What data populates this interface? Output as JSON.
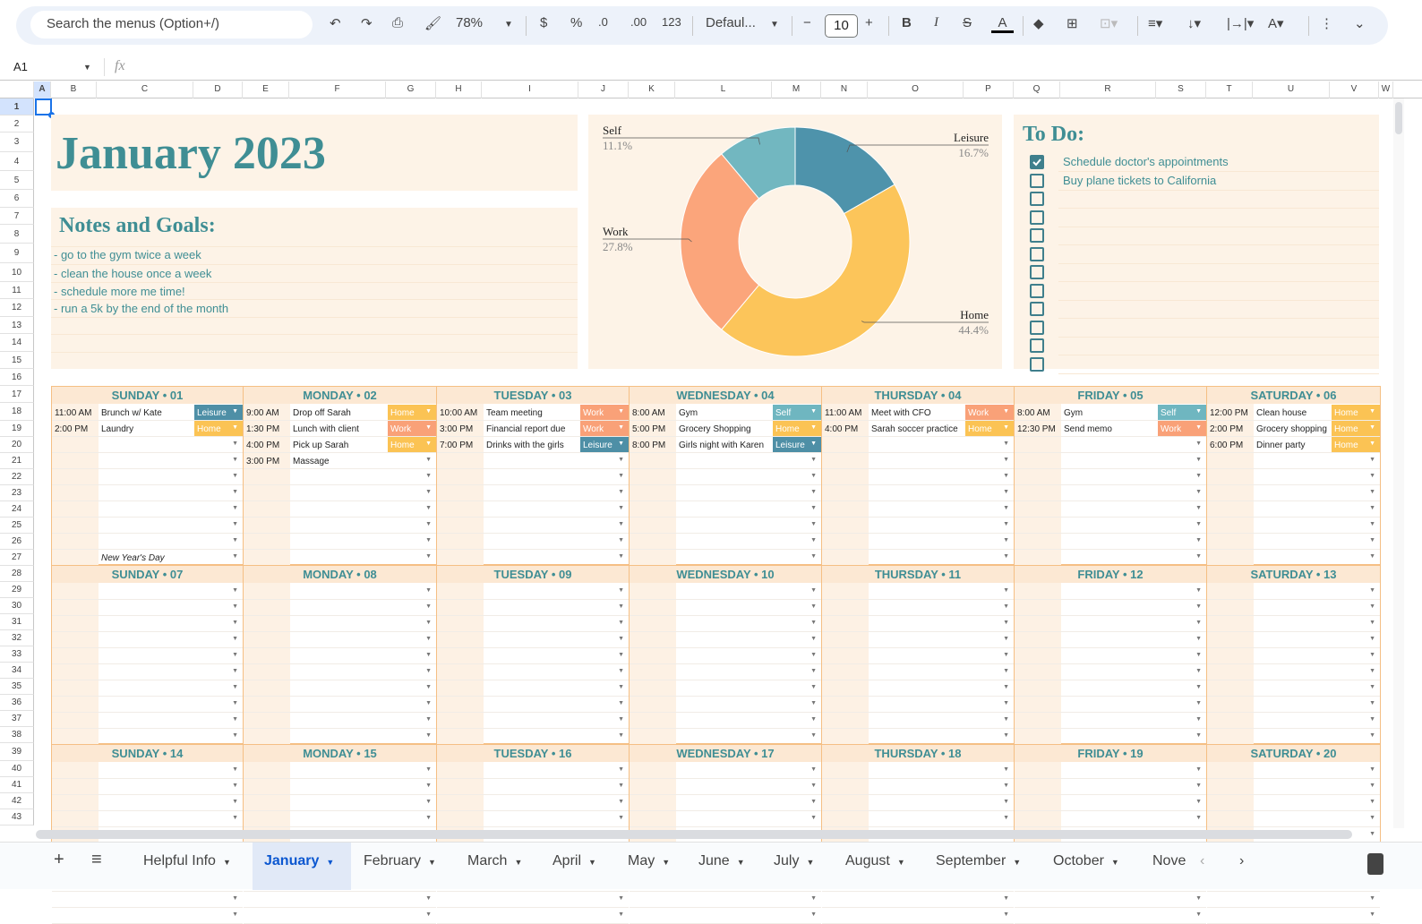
{
  "toolbar": {
    "search_placeholder": "Search the menus (Option+/)",
    "zoom": "78%",
    "currency": "$",
    "percent": "%",
    "dec_less": ".0",
    "dec_more": ".00",
    "format_123": "123",
    "font": "Defaul...",
    "font_size": "10",
    "bold": "B",
    "italic": "I",
    "text_color": "A"
  },
  "formula_bar": {
    "cell_ref": "A1",
    "fx": "fx"
  },
  "columns": [
    "A",
    "B",
    "C",
    "D",
    "E",
    "F",
    "G",
    "H",
    "I",
    "J",
    "K",
    "L",
    "M",
    "N",
    "O",
    "P",
    "Q",
    "R",
    "S",
    "T",
    "U",
    "V",
    "W"
  ],
  "rows": [
    1,
    2,
    3,
    4,
    5,
    6,
    7,
    8,
    9,
    10,
    11,
    12,
    13,
    14,
    15,
    16,
    17,
    18,
    19,
    20,
    21,
    22,
    23,
    24,
    25,
    26,
    27,
    28,
    29,
    30,
    31,
    32,
    33,
    34,
    35,
    36,
    37,
    38,
    39,
    40,
    41,
    42,
    43
  ],
  "header": {
    "title": "January 2023"
  },
  "notes": {
    "title": "Notes and Goals:",
    "items": [
      "- go to the gym twice a week",
      "- clean the house once a week",
      "- schedule more me time!",
      "- run a 5k by the end of the month"
    ]
  },
  "chart_data": {
    "type": "pie",
    "donut": true,
    "categories": [
      "Leisure",
      "Home",
      "Work",
      "Self"
    ],
    "values": [
      16.7,
      44.4,
      27.8,
      11.1
    ],
    "labels": [
      "16.7%",
      "44.4%",
      "27.8%",
      "11.1%"
    ],
    "colors": [
      "#4e93ab",
      "#fcc55a",
      "#fba57b",
      "#72b7c0"
    ]
  },
  "todo": {
    "title": "To Do:",
    "items": [
      {
        "text": "Schedule doctor's appointments",
        "checked": true
      },
      {
        "text": "Buy plane tickets to California",
        "checked": false
      },
      {
        "text": "",
        "checked": false
      },
      {
        "text": "",
        "checked": false
      },
      {
        "text": "",
        "checked": false
      },
      {
        "text": "",
        "checked": false
      },
      {
        "text": "",
        "checked": false
      },
      {
        "text": "",
        "checked": false
      },
      {
        "text": "",
        "checked": false
      },
      {
        "text": "",
        "checked": false
      },
      {
        "text": "",
        "checked": false
      },
      {
        "text": "",
        "checked": false
      }
    ]
  },
  "category_colors": {
    "Leisure": "#4e8fa6",
    "Home": "#fbc354",
    "Work": "#f9a178",
    "Self": "#6fb6c0"
  },
  "weeks": [
    [
      {
        "name": "SUNDAY • 01",
        "events": [
          {
            "time": "11:00 AM",
            "title": "Brunch w/ Kate",
            "cat": "Leisure"
          },
          {
            "time": "2:00 PM",
            "title": "Laundry",
            "cat": "Home"
          }
        ],
        "footer": "New Year's Day"
      },
      {
        "name": "MONDAY • 02",
        "events": [
          {
            "time": "9:00 AM",
            "title": "Drop off Sarah",
            "cat": "Home"
          },
          {
            "time": "1:30 PM",
            "title": "Lunch with client",
            "cat": "Work"
          },
          {
            "time": "4:00 PM",
            "title": "Pick up Sarah",
            "cat": "Home"
          },
          {
            "time": "3:00 PM",
            "title": "Massage",
            "cat": ""
          }
        ]
      },
      {
        "name": "TUESDAY • 03",
        "events": [
          {
            "time": "10:00 AM",
            "title": "Team meeting",
            "cat": "Work"
          },
          {
            "time": "3:00 PM",
            "title": "Financial report due",
            "cat": "Work"
          },
          {
            "time": "7:00 PM",
            "title": "Drinks with the girls",
            "cat": "Leisure"
          }
        ]
      },
      {
        "name": "WEDNESDAY • 04",
        "events": [
          {
            "time": "8:00 AM",
            "title": "Gym",
            "cat": "Self"
          },
          {
            "time": "5:00 PM",
            "title": "Grocery Shopping",
            "cat": "Home"
          },
          {
            "time": "8:00 PM",
            "title": "Girls night with Karen",
            "cat": "Leisure"
          }
        ]
      },
      {
        "name": "THURSDAY • 04",
        "events": [
          {
            "time": "11:00 AM",
            "title": "Meet with CFO",
            "cat": "Work"
          },
          {
            "time": "4:00 PM",
            "title": "Sarah soccer practice",
            "cat": "Home"
          }
        ]
      },
      {
        "name": "FRIDAY • 05",
        "events": [
          {
            "time": "8:00 AM",
            "title": "Gym",
            "cat": "Self"
          },
          {
            "time": "12:30 PM",
            "title": "Send memo",
            "cat": "Work"
          }
        ]
      },
      {
        "name": "SATURDAY • 06",
        "events": [
          {
            "time": "12:00 PM",
            "title": "Clean house",
            "cat": "Home"
          },
          {
            "time": "2:00 PM",
            "title": "Grocery shopping",
            "cat": "Home"
          },
          {
            "time": "6:00 PM",
            "title": "Dinner party",
            "cat": "Home"
          }
        ]
      }
    ],
    [
      {
        "name": "SUNDAY • 07",
        "events": []
      },
      {
        "name": "MONDAY • 08",
        "events": []
      },
      {
        "name": "TUESDAY • 09",
        "events": []
      },
      {
        "name": "WEDNESDAY • 10",
        "events": []
      },
      {
        "name": "THURSDAY • 11",
        "events": []
      },
      {
        "name": "FRIDAY • 12",
        "events": []
      },
      {
        "name": "SATURDAY • 13",
        "events": []
      }
    ],
    [
      {
        "name": "SUNDAY • 14",
        "events": []
      },
      {
        "name": "MONDAY • 15",
        "events": []
      },
      {
        "name": "TUESDAY • 16",
        "events": []
      },
      {
        "name": "WEDNESDAY • 17",
        "events": []
      },
      {
        "name": "THURSDAY • 18",
        "events": []
      },
      {
        "name": "FRIDAY • 19",
        "events": []
      },
      {
        "name": "SATURDAY • 20",
        "events": []
      }
    ]
  ],
  "sheet_tabs": [
    "Helpful Info",
    "January",
    "February",
    "March",
    "April",
    "May",
    "June",
    "July",
    "August",
    "September",
    "October",
    "Nove"
  ],
  "active_tab": "January"
}
